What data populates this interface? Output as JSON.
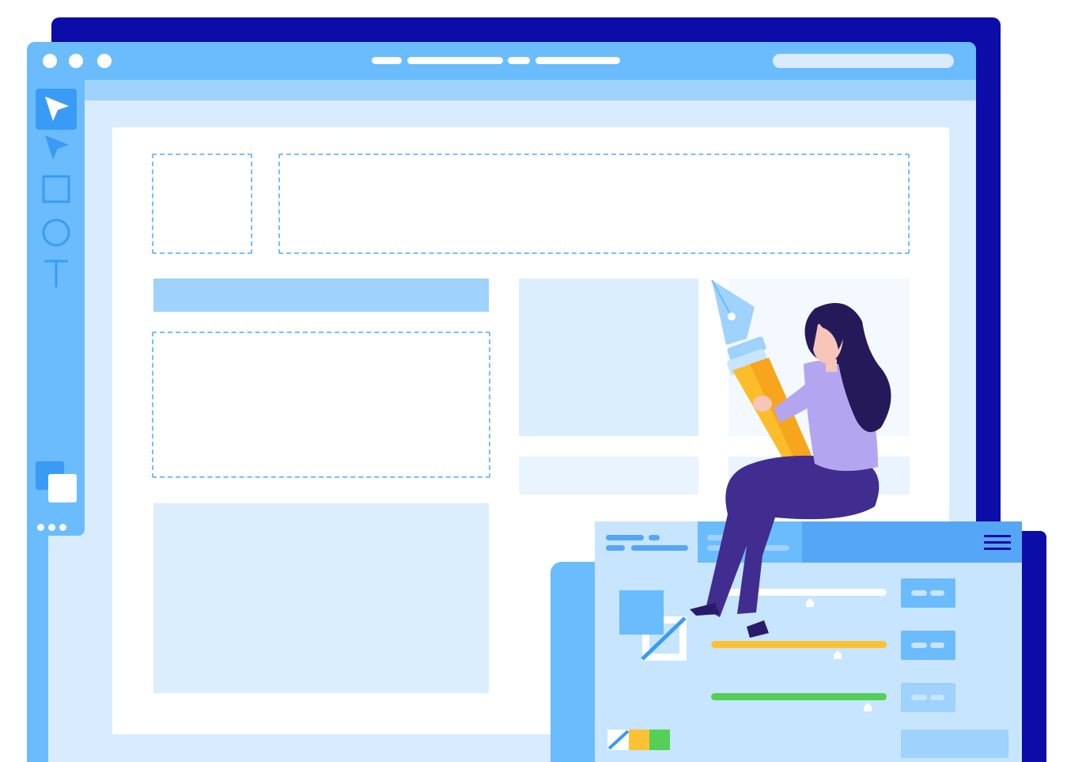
{
  "colors": {
    "navy_shadow": "#0c0ca8",
    "window_bg": "#d9ecfe",
    "titlebar": "#6bbcfc",
    "accent_blue": "#3a9bf6",
    "light_blue": "#9fd2fd",
    "slider_yellow": "#fcc233",
    "slider_green": "#55cf55",
    "pencil_yellow": "#fbbd2c",
    "shirt_lavender": "#b4a5f0",
    "pants_purple": "#412c8f",
    "hair_dark": "#25195a"
  },
  "toolbar": {
    "tools": [
      {
        "icon": "select-arrow-icon",
        "active": true
      },
      {
        "icon": "direct-select-arrow-icon",
        "active": false
      },
      {
        "icon": "rectangle-icon",
        "active": false
      },
      {
        "icon": "ellipse-icon",
        "active": false
      },
      {
        "icon": "text-tool-icon",
        "active": false
      }
    ],
    "bottom_icon": "color-swatches-icon",
    "more_icon": "more-dots-icon"
  },
  "properties_panel": {
    "sliders": [
      {
        "color": "#ffffff",
        "level": 0.56
      },
      {
        "color": "#fcc233",
        "level": 0.72
      },
      {
        "color": "#55cf55",
        "level": 0.89
      }
    ],
    "menu_icon": "hamburger-menu-icon",
    "fill_icon": "fill-stroke-icon",
    "palette_icon": "color-palette-icon"
  },
  "illustration": {
    "character": "woman-with-pen-nib-pencil"
  }
}
